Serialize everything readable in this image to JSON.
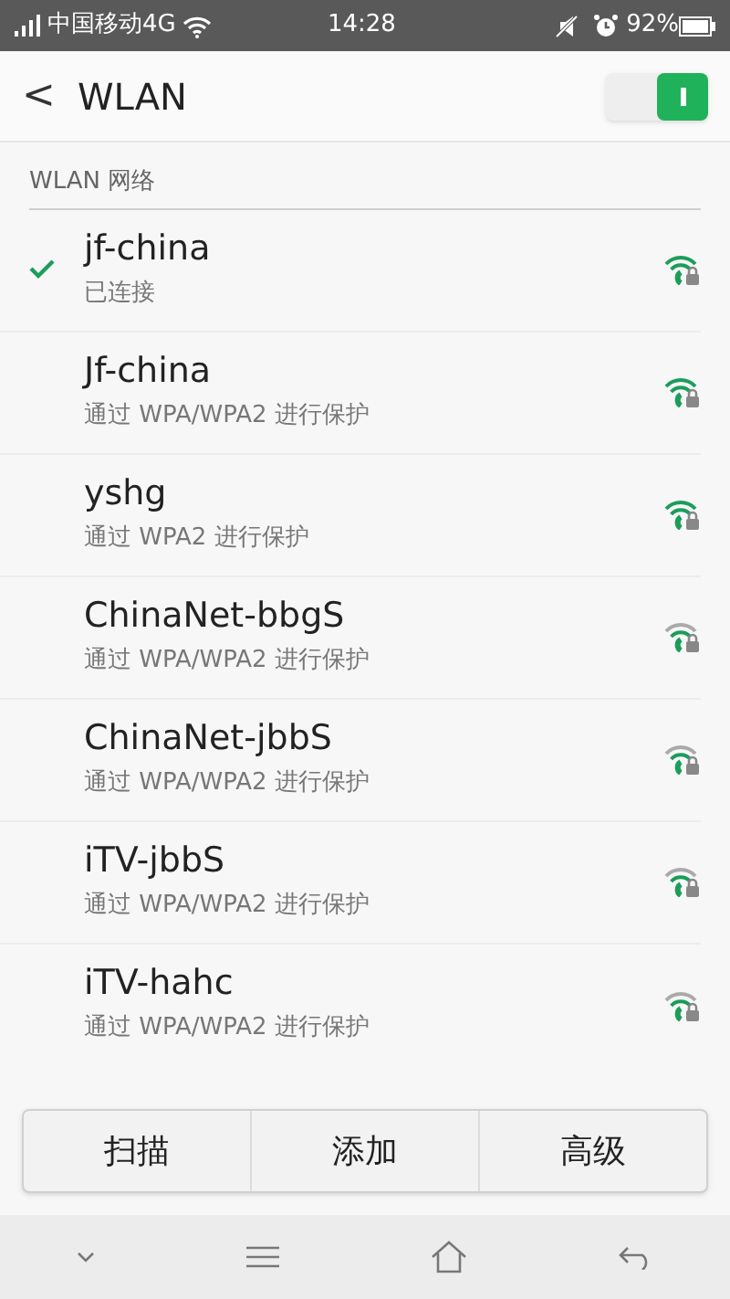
{
  "status_bar": {
    "carrier": "中国移动4G",
    "time": "14:28",
    "battery": "92%"
  },
  "header": {
    "back": "<",
    "title": "WLAN",
    "wlan_switch": {
      "on": true
    }
  },
  "section_label": "WLAN 网络",
  "networks": [
    {
      "name": "jf-china",
      "subtitle": "已连接",
      "selected": true,
      "strong": true
    },
    {
      "name": "Jf-china",
      "subtitle": "通过 WPA/WPA2 进行保护",
      "selected": false,
      "strong": true
    },
    {
      "name": "yshg",
      "subtitle": "通过 WPA2 进行保护",
      "selected": false,
      "strong": true
    },
    {
      "name": "ChinaNet-bbgS",
      "subtitle": "通过 WPA/WPA2 进行保护",
      "selected": false,
      "strong": false
    },
    {
      "name": "ChinaNet-jbbS",
      "subtitle": "通过 WPA/WPA2 进行保护",
      "selected": false,
      "strong": false
    },
    {
      "name": "iTV-jbbS",
      "subtitle": "通过 WPA/WPA2 进行保护",
      "selected": false,
      "strong": false
    },
    {
      "name": "iTV-hahc",
      "subtitle": "通过 WPA/WPA2 进行保护",
      "selected": false,
      "strong": false
    }
  ],
  "buttons": [
    "扫描",
    "添加",
    "高级"
  ]
}
